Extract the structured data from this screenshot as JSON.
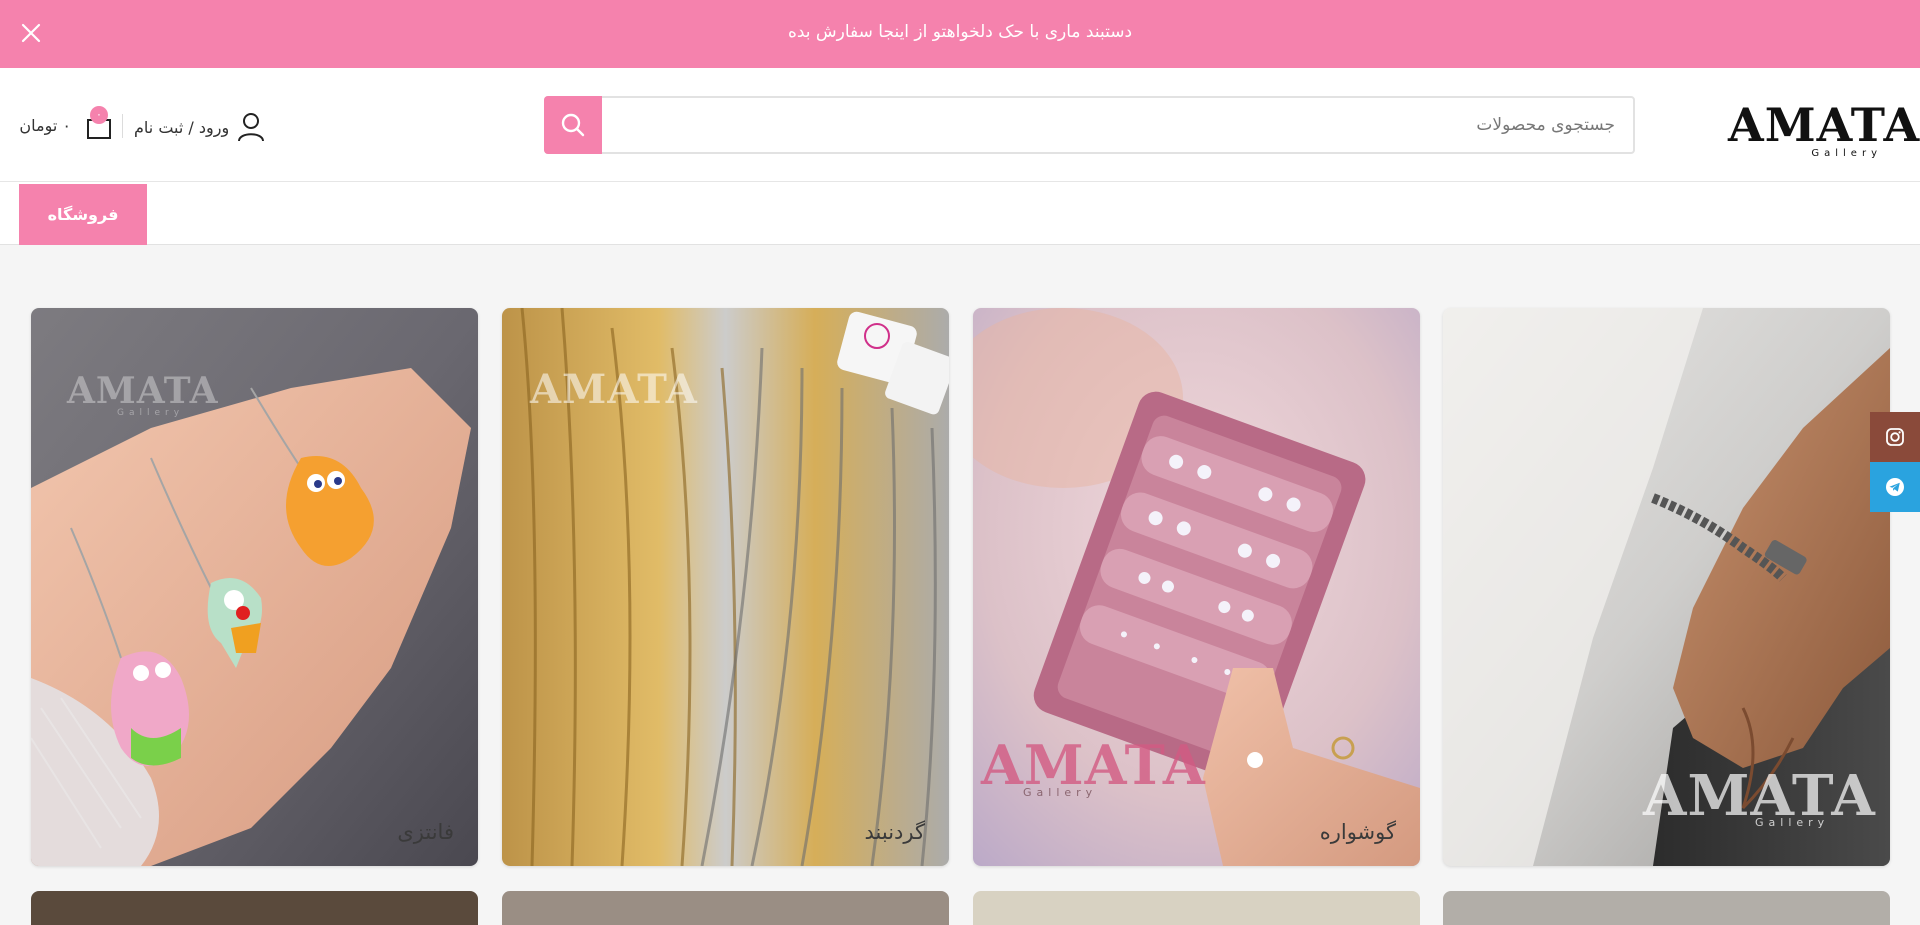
{
  "banner": {
    "text": "دستبند ماری با حک دلخواهتو از اینجا سفارش بده"
  },
  "header": {
    "logo_main": "AMATA",
    "logo_sub": "Gallery",
    "search_placeholder": "جستجوی محصولات",
    "account_label": "ورود / ثبت نام",
    "cart_count": "۰",
    "cart_total": "۰ تومان"
  },
  "nav": {
    "shop_label": "فروشگاه"
  },
  "categories": [
    {
      "label": "",
      "watermark": "AMATA",
      "watermark_sub": "Gallery"
    },
    {
      "label": "گوشواره",
      "watermark": "AMATA",
      "watermark_sub": "Gallery"
    },
    {
      "label": "گردنبند",
      "watermark": "AMATA",
      "watermark_sub": ""
    },
    {
      "label": "فانتزی",
      "watermark": "AMATA",
      "watermark_sub": "Gallery"
    }
  ],
  "colors": {
    "accent": "#f582ad",
    "instagram": "#8a4a3a",
    "telegram": "#2aa3df"
  },
  "icons": [
    "close-icon",
    "search-icon",
    "user-icon",
    "bag-icon",
    "instagram-icon",
    "telegram-icon"
  ]
}
